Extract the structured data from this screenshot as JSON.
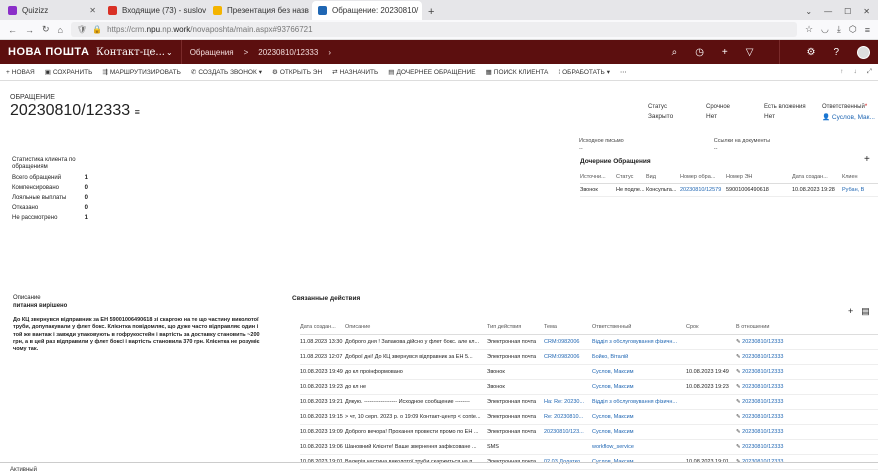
{
  "browser": {
    "tabs": [
      {
        "title": "Quizizz",
        "color": "#8b2fc9"
      },
      {
        "title": "Входящие (73) - suslov",
        "color": "#d93025"
      },
      {
        "title": "Презентация без назв",
        "color": "#f4b400"
      },
      {
        "title": "Обращение: 20230810/",
        "color": "#1f66b3"
      }
    ],
    "url_prefix": "https://crm.",
    "url_bold": "npu",
    "url_mid": ".np.",
    "url_work": "work",
    "url_suffix": "/novaposhta/main.aspx#93766721"
  },
  "app": {
    "logo": "НОВА ПОШТА",
    "name": "Контакт-це...",
    "breadcrumb": [
      "Обращения",
      ">",
      "20230810/12333",
      "›"
    ]
  },
  "toolbar": [
    "НОВАЯ",
    "СОХРАНИТЬ",
    "МАРШРУТИЗИРОВАТЬ",
    "СОЗДАТЬ ЗВОНОК",
    "ОТКРЫТЬ ЭН",
    "НАЗНАЧИТЬ",
    "ДОЧЕРНЕЕ ОБРАЩЕНИЕ",
    "ПОИСК КЛИЕНТА",
    "ОБРАБОТАТЬ"
  ],
  "header": {
    "entity_type": "ОБРАЩЕНИЕ",
    "title": "20230810/12333",
    "fields": [
      {
        "label": "Статус",
        "value": "Закрыто"
      },
      {
        "label": "Срочное",
        "value": "Нет"
      },
      {
        "label": "Есть вложения",
        "value": "Нет"
      },
      {
        "label": "Ответственный",
        "value": "Суслов, Мак..."
      }
    ]
  },
  "stats": {
    "title": "Статистика клиента по обращениям",
    "rows": [
      {
        "label": "Всего обращений",
        "value": "1"
      },
      {
        "label": "Компенсировано",
        "value": "0"
      },
      {
        "label": "Лояльные выплаты",
        "value": "0"
      },
      {
        "label": "Отказано",
        "value": "0"
      },
      {
        "label": "Не рассмотрено",
        "value": "1"
      }
    ]
  },
  "docs": [
    {
      "label": "Исходное письмо",
      "value": "--"
    },
    {
      "label": "Ссылки на документы",
      "value": "--"
    }
  ],
  "child": {
    "title": "Дочерние Обращения",
    "headers": [
      "Источни...",
      "Статус",
      "Вид",
      "Номер обра...",
      "Номер ЭН",
      "Дата создан...",
      "Клиен"
    ],
    "rows": [
      [
        "Звонок",
        "Не подле...",
        "Консульта...",
        "20230810/12579",
        "59001006490618",
        "10.08.2023 19:28",
        "Рубан, В"
      ]
    ]
  },
  "description": {
    "label": "Описание",
    "subject": "питання вирішено",
    "body": "До КЦ звернувся відправник за ЕН 59001006490618 зі скаргою на те що частину виколотої труби, допупакували у флет бокс. Клієнтка повідомляє, що дуже часто відправляє один і той же вантаж і завжди упаковують в гофрукостейн і вартість за доставку становить ~200 грн, а в цей раз відправили у флет боксі і вартість становила 370 грн. Клієнтка не розуміє чому так."
  },
  "related": {
    "title": "Связанные действия",
    "headers": [
      "Дата создан...",
      "Описание",
      "Тип действия",
      "Тема",
      "Ответственный",
      "Срок",
      "В отношении"
    ],
    "rows": [
      [
        "11.08.2023 13:30",
        "Доброго дня ! Запакова дійсно у флет бокс. але кл...",
        "Электронная почта",
        "CRM:0982006",
        "Відділ з обслуговування фізичн...",
        "",
        "20230810/12333"
      ],
      [
        "11.08.2023 12:07",
        "Доброї дні! До КЦ звернувся відправник за ЕН 5...",
        "Электронная почта",
        "CRM:0982006",
        "Бойко, Віталій",
        "",
        "20230810/12333"
      ],
      [
        "10.08.2023 19:49",
        "до кл проінформовано",
        "Звонок",
        "",
        "Суслов, Максим",
        "10.08.2023 19:49",
        "20230810/12333"
      ],
      [
        "10.08.2023 19:23",
        "до кл не",
        "Звонок",
        "",
        "Суслов, Максим",
        "10.08.2023 19:23",
        "20230810/12333"
      ],
      [
        "10.08.2023 19:21",
        "Дякую. ------------------ Исходное сообщение --------",
        "Электронная почта",
        "На: Re: 20230...",
        "Відділ з обслуговування фізичн...",
        "",
        "20230810/12333"
      ],
      [
        "10.08.2023 19:15",
        "> чт, 10 серп. 2023 р. о 19:09 Контакт-центр < conte...",
        "Электронная почта",
        "Re: 20230810...",
        "Суслов, Максим",
        "",
        "20230810/12333"
      ],
      [
        "10.08.2023 19:09",
        "Доброго вечора! Прохання провести промо по ЕН ...",
        "Электронная почта",
        "20230810/123...",
        "Суслов, Максим",
        "",
        "20230810/12333"
      ],
      [
        "10.08.2023 19:06",
        "Шановний Клієнте! Ваше звернення зафіксоване ...",
        "SMS",
        "",
        "workflow_service",
        "",
        "20230810/12333"
      ],
      [
        "10.08.2023 19:01",
        "Валерія частина виколотої труби скаржиться на п...",
        "Электронная почта",
        "02.03 Додатко...",
        "Суслов, Максим",
        "10.08.2023 19:01",
        "20230810/12333"
      ]
    ]
  },
  "status_bar": "Активный"
}
